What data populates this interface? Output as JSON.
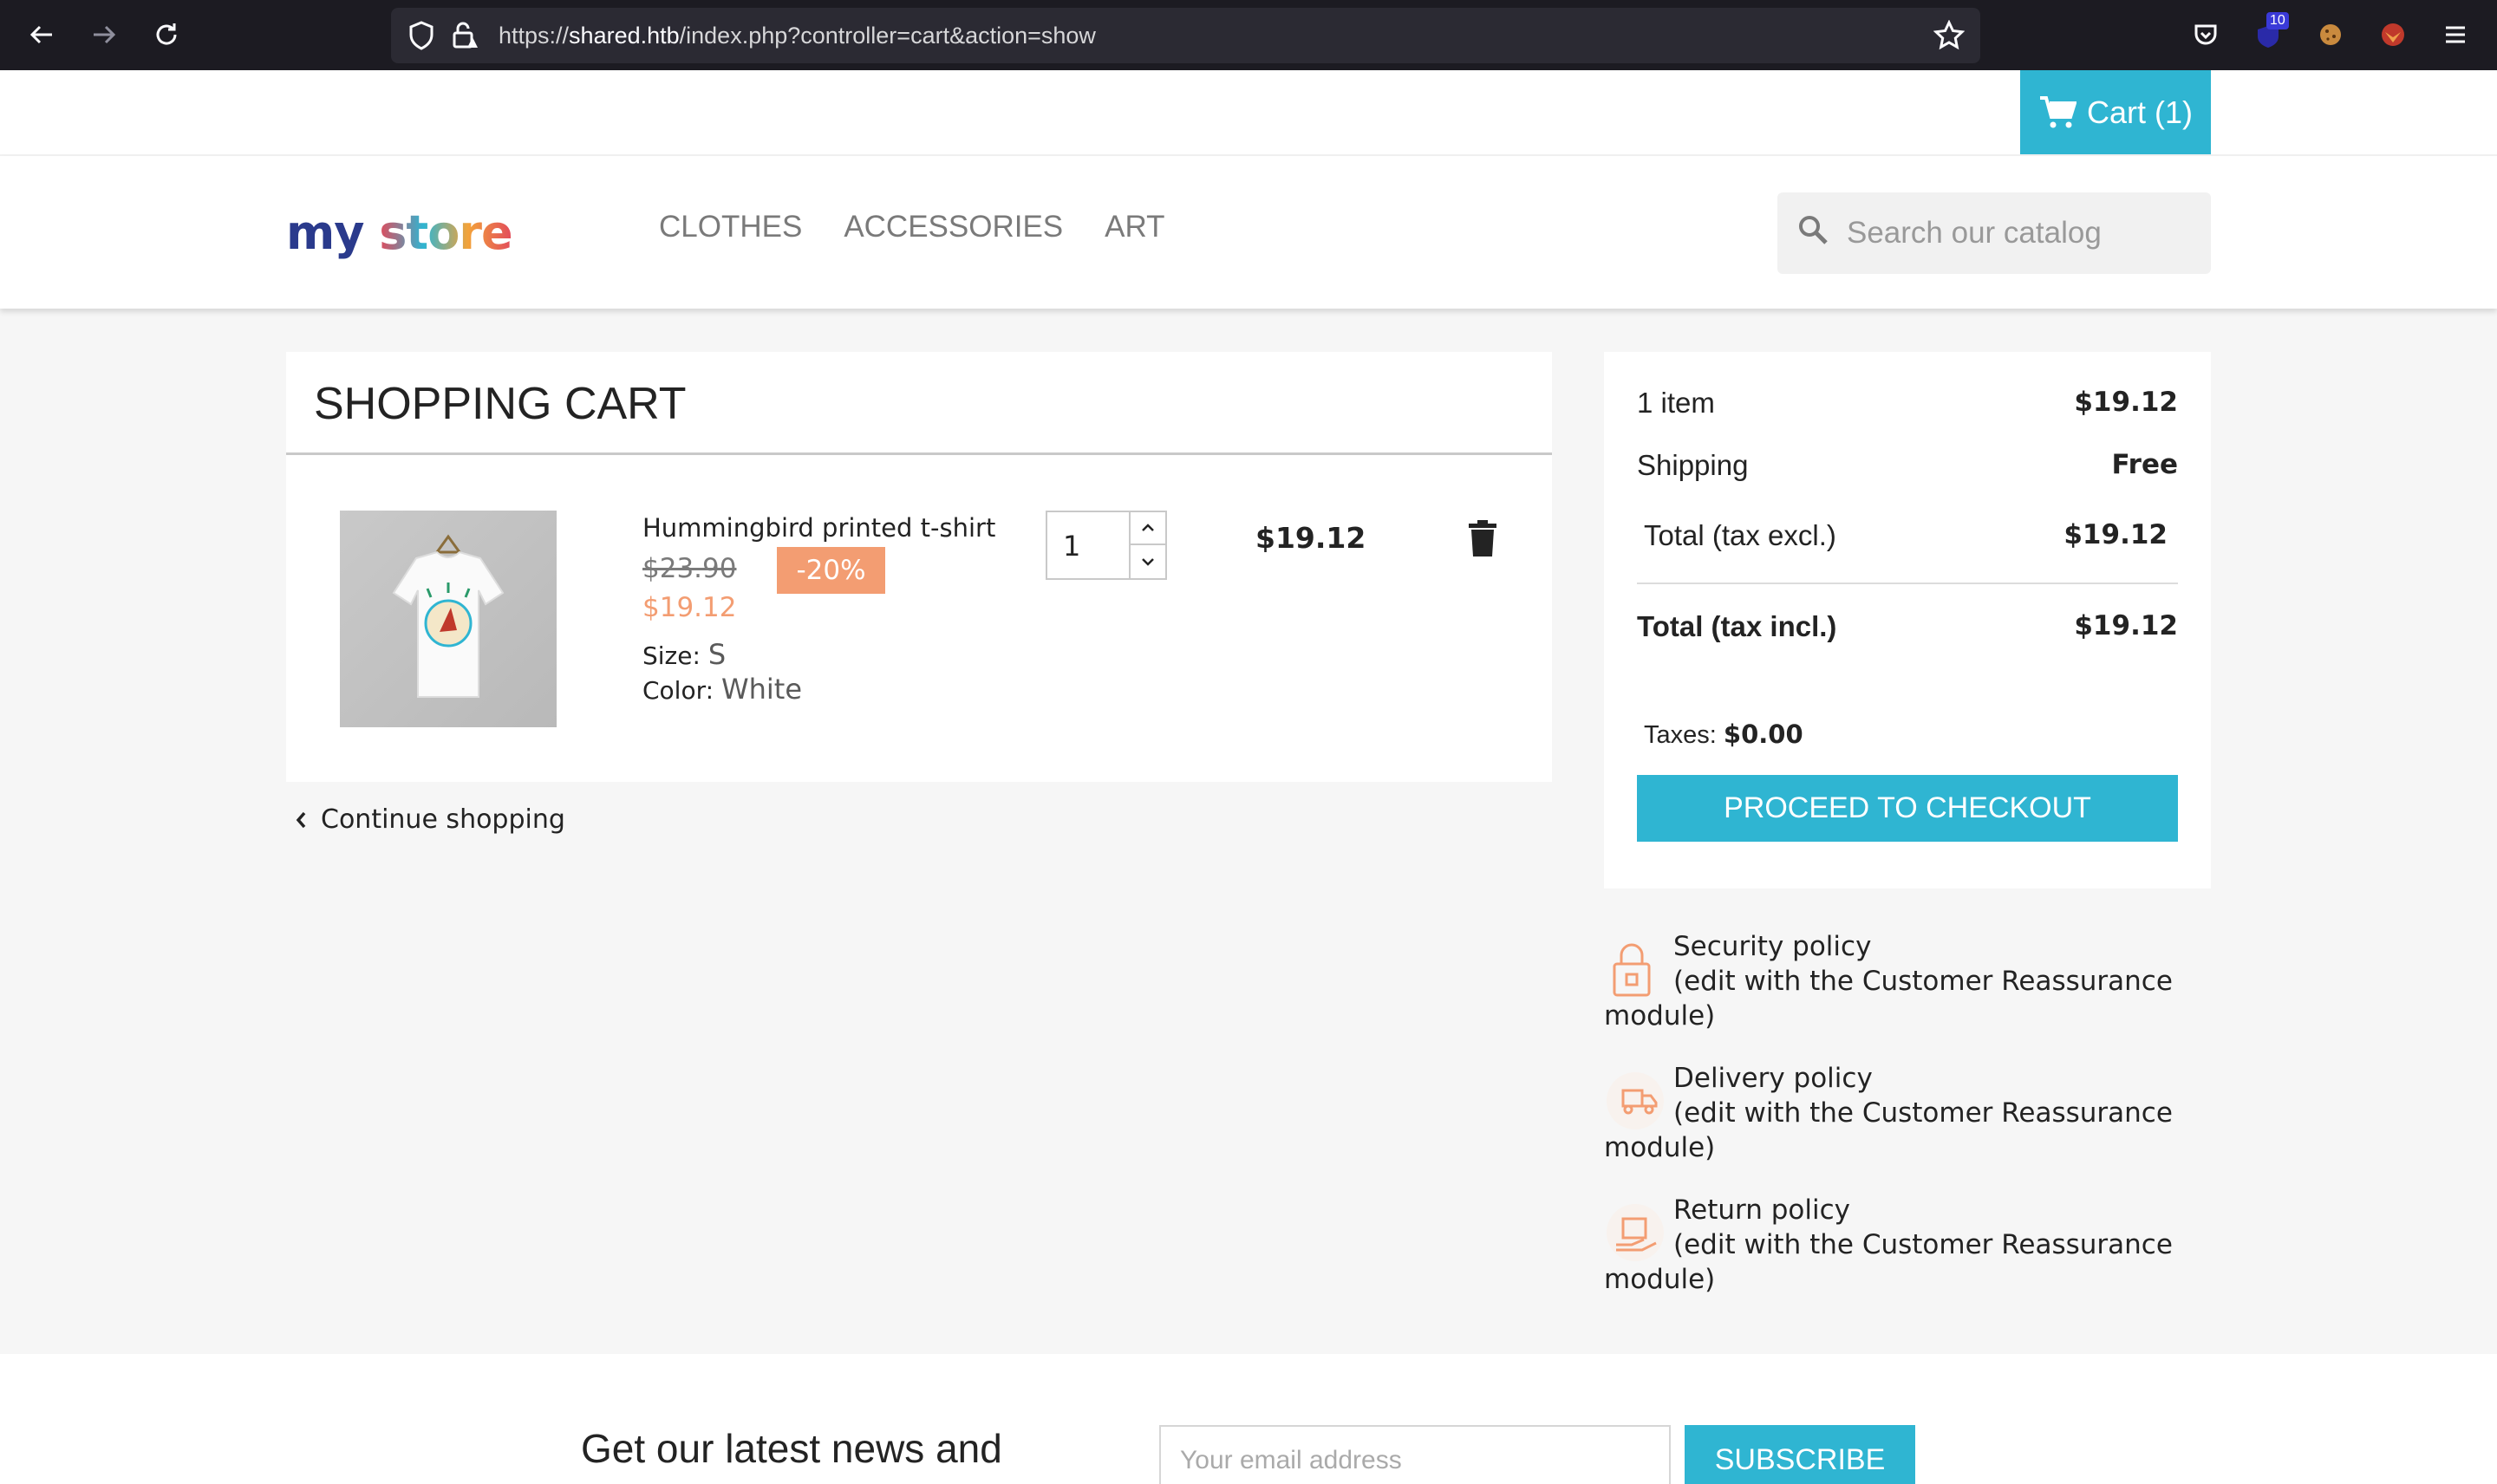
{
  "browser": {
    "url_prefix": "https://",
    "url_host": "shared.htb",
    "url_path": "/index.php?controller=cart&action=show",
    "extension_badge": "10"
  },
  "topbar": {
    "cart_label": "Cart (1)"
  },
  "header": {
    "logo_text_1": "my",
    "logo_text_2": "store",
    "menu": [
      "CLOTHES",
      "ACCESSORIES",
      "ART"
    ],
    "search_placeholder": "Search our catalog"
  },
  "cart": {
    "title": "SHOPPING CART",
    "item": {
      "name": "Hummingbird printed t-shirt",
      "old_price": "$23.90",
      "discount": "-20%",
      "price": "$19.12",
      "size_label": "Size:",
      "size_value": "S",
      "color_label": "Color:",
      "color_value": "White",
      "quantity": "1",
      "line_total": "$19.12"
    },
    "continue_label": "Continue shopping"
  },
  "summary": {
    "items_label": "1 item",
    "items_amount": "$19.12",
    "shipping_label": "Shipping",
    "shipping_amount": "Free",
    "total_excl_label": "Total (tax excl.)",
    "total_excl_amount": "$19.12",
    "total_incl_label": "Total (tax incl.)",
    "total_incl_amount": "$19.12",
    "taxes_label": "Taxes:",
    "taxes_amount": "$0.00",
    "checkout_label": "PROCEED TO CHECKOUT"
  },
  "reassurance": [
    {
      "title": "Security policy",
      "desc": "(edit with the Customer Reassurance",
      "desc2": "module)",
      "icon": "lock-icon"
    },
    {
      "title": "Delivery policy",
      "desc": "(edit with the Customer Reassurance",
      "desc2": "module)",
      "icon": "truck-icon"
    },
    {
      "title": "Return policy",
      "desc": "(edit with the Customer Reassurance",
      "desc2": "module)",
      "icon": "return-box-icon"
    }
  ],
  "newsletter": {
    "title": "Get our latest news and",
    "placeholder": "Your email address",
    "button": "SUBSCRIBE"
  },
  "colors": {
    "accent": "#2fb5d2",
    "discount": "#f39d72"
  }
}
